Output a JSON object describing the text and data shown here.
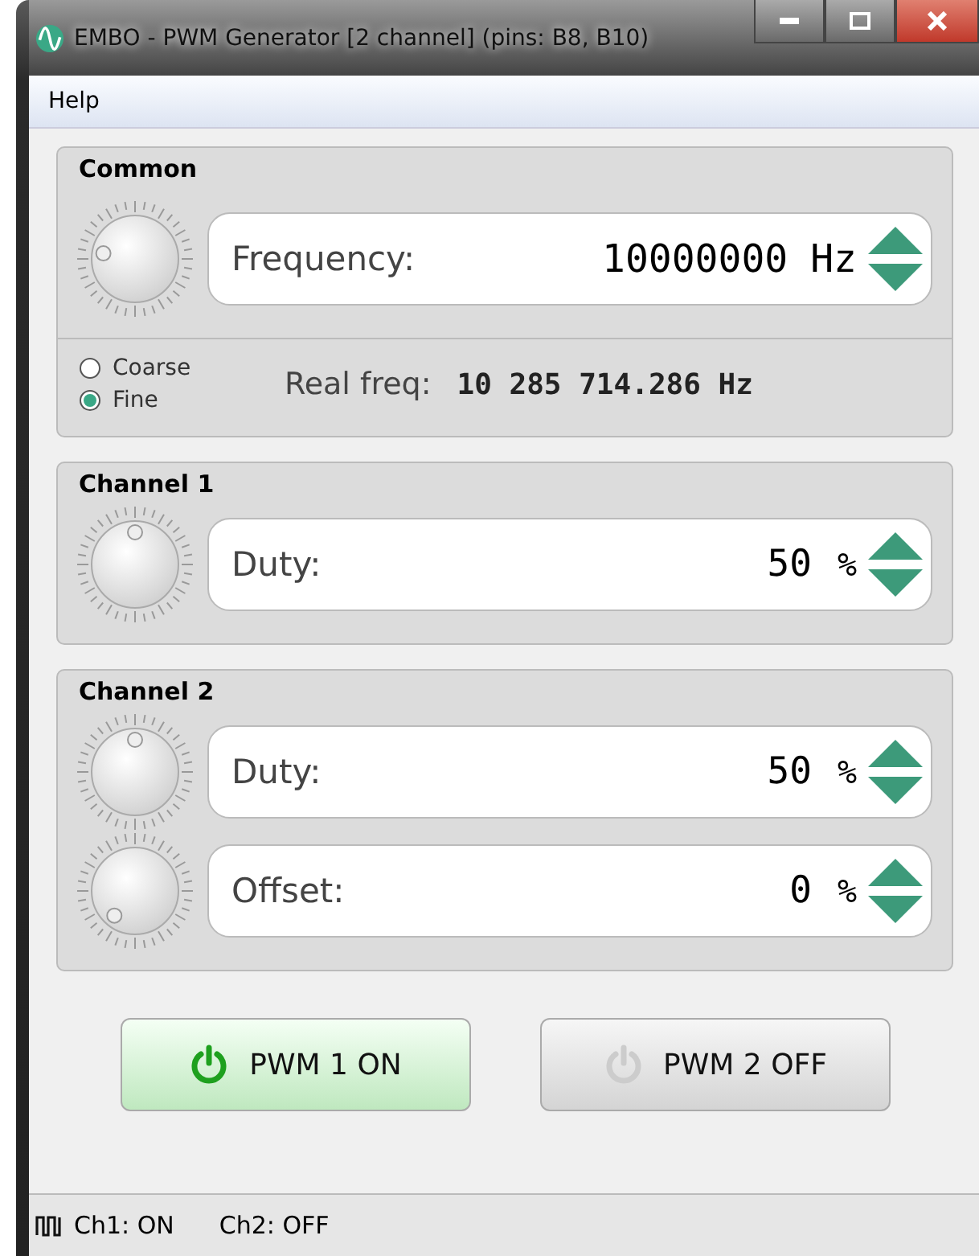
{
  "window": {
    "title": "EMBO - PWM Generator [2 channel] (pins: B8, B10)"
  },
  "menu": [
    "Help"
  ],
  "groups": [
    {
      "title": "Common",
      "controls": [
        {
          "label": "Frequency:",
          "value": "10000000",
          "unit": "Hz"
        }
      ],
      "modes": [
        {
          "label": "Coarse",
          "selected": false
        },
        {
          "label": "Fine",
          "selected": true
        }
      ],
      "real_label": "Real freq:",
      "real_value": "10 285 714.286 Hz"
    },
    {
      "title": "Channel 1",
      "controls": [
        {
          "label": "Duty:",
          "value": "50",
          "unit": "%"
        }
      ]
    },
    {
      "title": "Channel 2",
      "controls": [
        {
          "label": "Duty:",
          "value": "50",
          "unit": "%"
        },
        {
          "label": "Offset:",
          "value": "0",
          "unit": "%"
        }
      ]
    }
  ],
  "buttons": [
    {
      "label": "PWM 1 ON",
      "on": true
    },
    {
      "label": "PWM 2 OFF",
      "on": false
    }
  ],
  "status_bar": [
    "Ch1: ON",
    "Ch2: OFF"
  ]
}
